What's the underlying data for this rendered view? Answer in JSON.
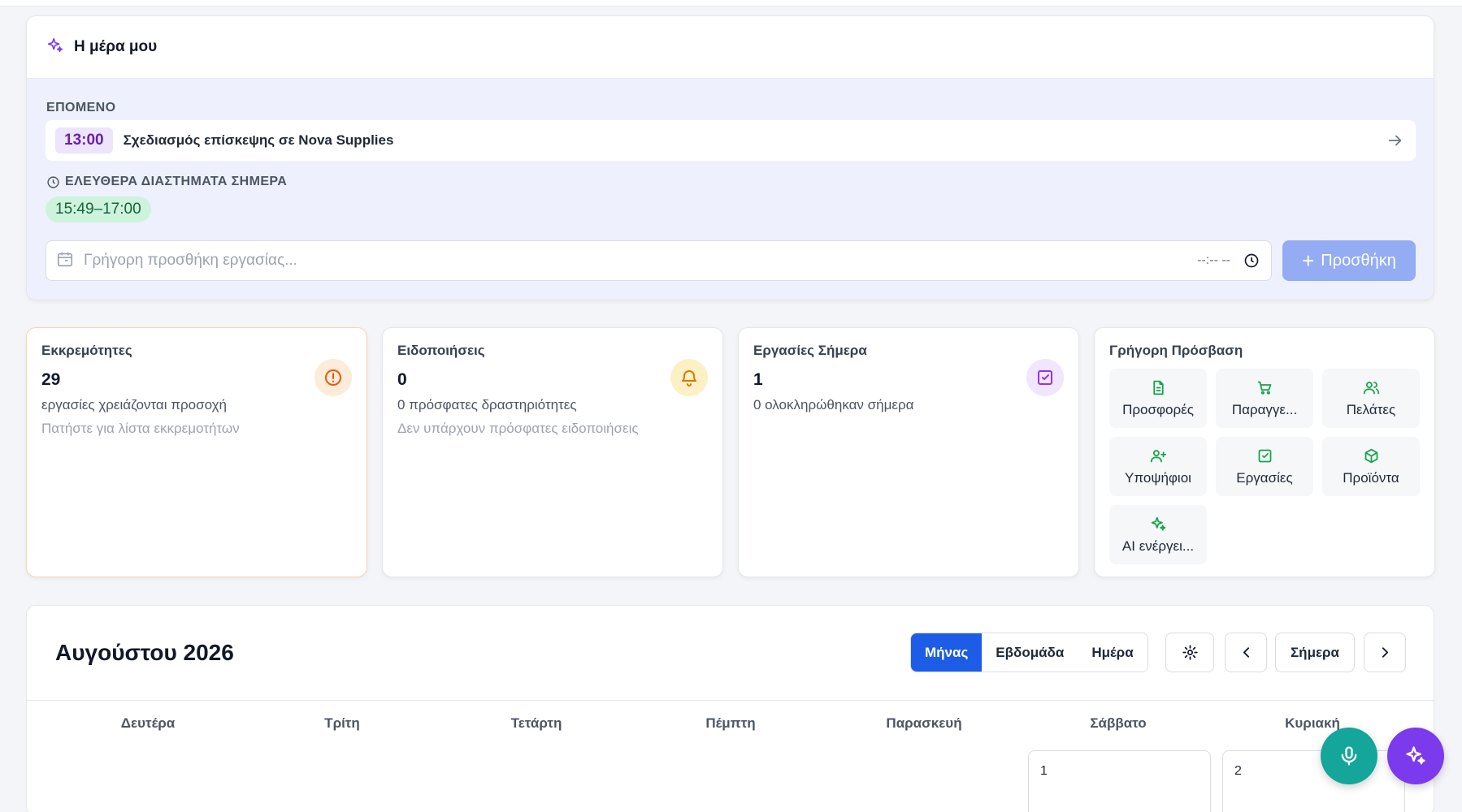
{
  "my_day": {
    "title": "Η μέρα μου",
    "next_label": "ΕΠΟΜΕΝΟ",
    "next_time": "13:00",
    "next_text": "Σχεδιασμός επίσκεψης σε Nova Supplies",
    "free_label": "ΕΛΕΥΘΕΡΑ ΔΙΑΣΤΗΜΑΤΑ ΣΗΜΕΡΑ",
    "free_slot": "15:49–17:00",
    "quick_placeholder": "Γρήγορη προσθήκη εργασίας...",
    "time_placeholder": "--:-- --",
    "add_label": "Προσθήκη"
  },
  "cards": {
    "pending": {
      "title": "Εκκρεμότητες",
      "value": "29",
      "sub": "εργασίες χρειάζονται προσοχή",
      "note": "Πατήστε για λίστα εκκρεμοτήτων"
    },
    "notifications": {
      "title": "Ειδοποιήσεις",
      "value": "0",
      "sub": "0 πρόσφατες δραστηριότητες",
      "note": "Δεν υπάρχουν πρόσφατες ειδοποιήσεις"
    },
    "tasks_today": {
      "title": "Εργασίες Σήμερα",
      "value": "1",
      "sub": "0 ολοκληρώθηκαν σήμερα"
    }
  },
  "quick_access": {
    "title": "Γρήγορη Πρόσβαση",
    "items": [
      {
        "label": "Προσφορές",
        "icon": "file-text-icon"
      },
      {
        "label": "Παραγγε...",
        "icon": "cart-icon"
      },
      {
        "label": "Πελάτες",
        "icon": "users-icon"
      },
      {
        "label": "Υποψήφιοι",
        "icon": "user-plus-icon"
      },
      {
        "label": "Εργασίες",
        "icon": "check-square-icon"
      },
      {
        "label": "Προϊόντα",
        "icon": "package-icon"
      },
      {
        "label": "AI ενέργει...",
        "icon": "sparkles-icon"
      }
    ]
  },
  "calendar": {
    "title": "Αυγούστου 2026",
    "views": [
      "Μήνας",
      "Εβδομάδα",
      "Ημέρα"
    ],
    "active_view": "Μήνας",
    "today_label": "Σήμερα",
    "weekdays": [
      "Δευτέρα",
      "Τρίτη",
      "Τετάρτη",
      "Πέμπτη",
      "Παρασκευή",
      "Σάββατο",
      "Κυριακή"
    ],
    "days": [
      "1",
      "2"
    ]
  },
  "colors": {
    "accent": "#1d5ce6",
    "accent_light": "#93acf3",
    "purple": "#7c3aed",
    "teal": "#14a59b",
    "green": "#16a34a",
    "orange": "#ea580c",
    "amber": "#d97706"
  }
}
